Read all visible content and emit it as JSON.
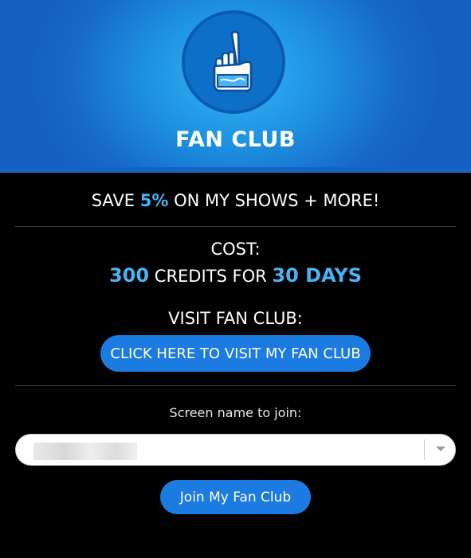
{
  "header": {
    "title": "FAN CLUB",
    "logo_icon": "foam-finger-icon",
    "background_color": "#1d8fe0"
  },
  "save": {
    "prefix": "SAVE",
    "percent": "5%",
    "suffix": "ON MY SHOWS + MORE!"
  },
  "cost": {
    "label": "COST:",
    "credits": "300",
    "middle": "CREDITS FOR",
    "days": "30 DAYS"
  },
  "visit": {
    "label": "VISIT FAN CLUB:",
    "button_label": "CLICK HERE TO VISIT MY FAN CLUB"
  },
  "join": {
    "screen_name_label": "Screen name to join:",
    "selected_value": "",
    "dropdown_icon": "chevron-down-icon",
    "button_label": "Join My Fan Club"
  },
  "colors": {
    "accent": "#4ab3f4",
    "button": "#1c7be0",
    "page_background": "#000000"
  }
}
